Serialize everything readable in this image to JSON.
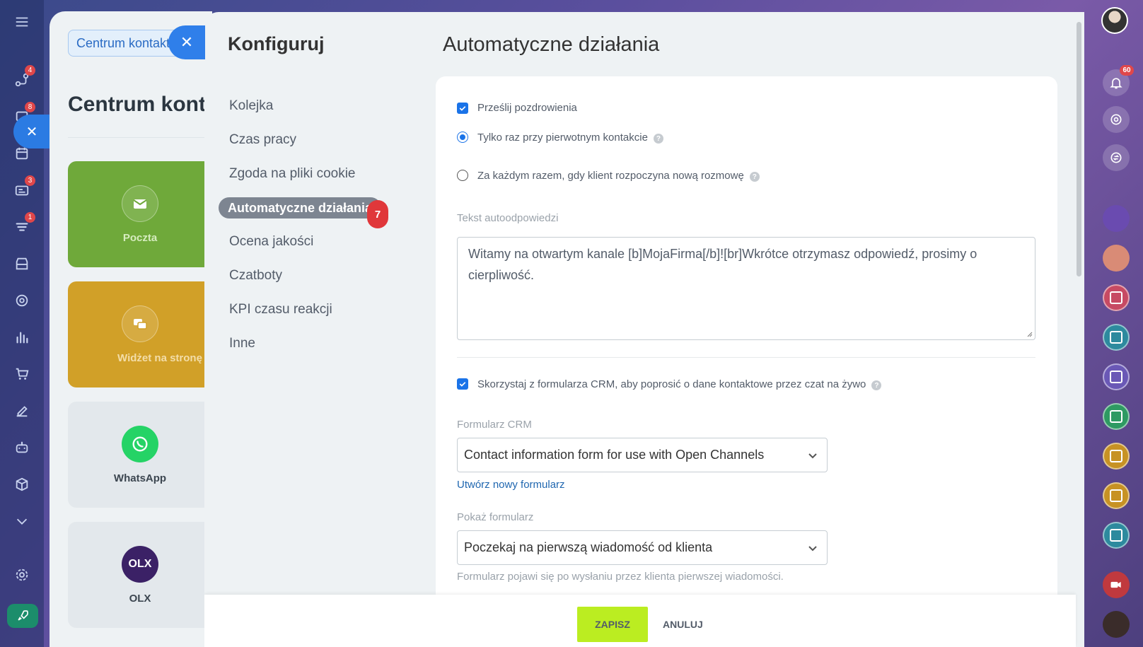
{
  "left_nav": {
    "badges": {
      "flows": "4",
      "chats": "8",
      "groups": "3",
      "contact_center": "1"
    }
  },
  "background_page": {
    "breadcrumb": "Centrum kontaktowe",
    "title": "Centrum kontaktowe",
    "cards": [
      {
        "label": "Poczta",
        "icon": "mail-icon"
      },
      {
        "label": "Widżet na stronę",
        "icon": "chat-bubbles-icon"
      },
      {
        "label": "WhatsApp",
        "icon": "whatsapp-icon"
      },
      {
        "label": "OLX",
        "icon": "olx-logo",
        "logo_text": "OLX"
      }
    ]
  },
  "right_bar": {
    "notifications_badge": "60"
  },
  "slider": {
    "menu_title": "Konfiguruj",
    "menu": [
      {
        "label": "Kolejka"
      },
      {
        "label": "Czas pracy"
      },
      {
        "label": "Zgoda na pliki cookie"
      },
      {
        "label": "Automatyczne działania",
        "active": true
      },
      {
        "label": "Ocena jakości"
      },
      {
        "label": "Czatboty"
      },
      {
        "label": "KPI czasu reakcji"
      },
      {
        "label": "Inne"
      }
    ],
    "step_badge": "7",
    "section_title": "Automatyczne działania",
    "greeting": {
      "checkbox_label": "Prześlij pozdrowienia",
      "checked": true,
      "option_once": "Tylko raz przy pierwotnym kontakcie",
      "option_every": "Za każdym razem, gdy klient rozpoczyna nową rozmowę",
      "selected": "once"
    },
    "autoreply": {
      "label": "Tekst autoodpowiedzi",
      "value": "Witamy na otwartym kanale [b]MojaFirma[/b]![br]Wkrótce otrzymasz odpowiedź, prosimy o cierpliwość."
    },
    "crm": {
      "checkbox_label": "Skorzystaj z formularza CRM, aby poprosić o dane kontaktowe przez czat na żywo",
      "checked": true,
      "form_label": "Formularz CRM",
      "form_value": "Contact information form for use with Open Channels",
      "create_link": "Utwórz nowy formularz",
      "show_label": "Pokaż formularz",
      "show_value": "Poczekaj na pierwszą wiadomość od klienta",
      "hint": "Formularz pojawi się po wysłaniu przez klienta pierwszej wiadomości."
    },
    "footer": {
      "save": "ZAPISZ",
      "cancel": "ANULUJ"
    }
  },
  "colors": {
    "accent_blue": "#1a73e8",
    "save_green": "#bbed21",
    "badge_red": "#e0373a"
  }
}
